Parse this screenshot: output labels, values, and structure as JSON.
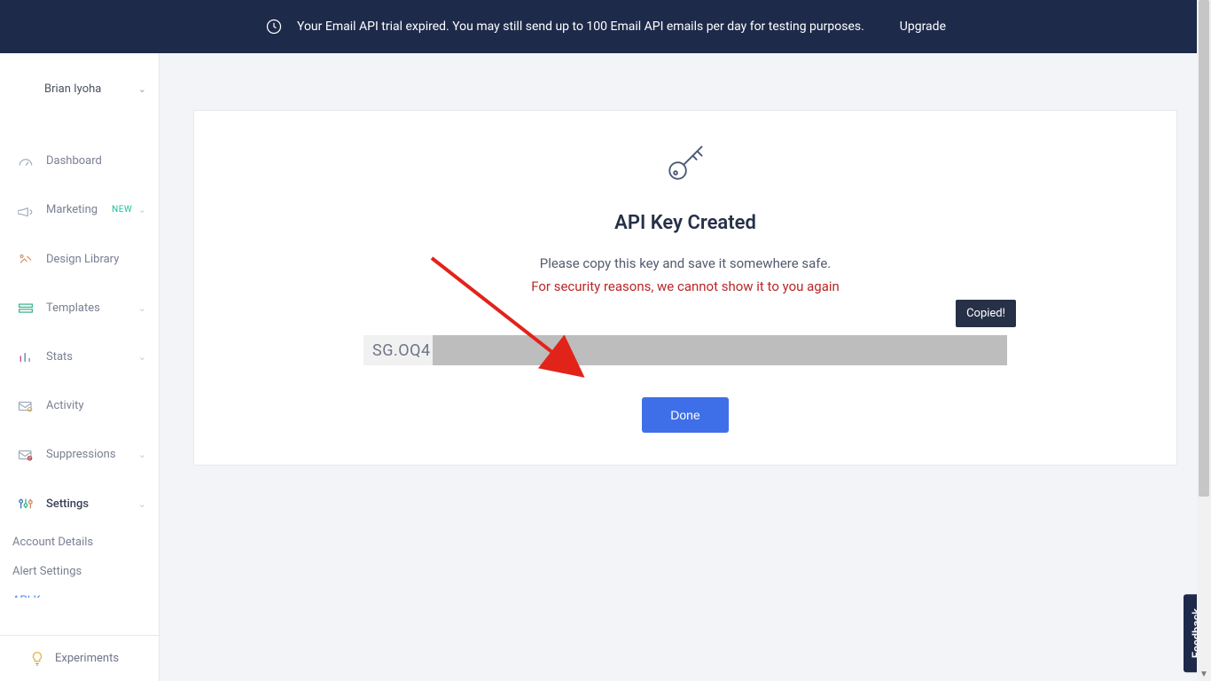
{
  "banner": {
    "message": "Your Email API trial expired. You may still send up to 100 Email API emails per day for testing purposes.",
    "upgrade": "Upgrade"
  },
  "user": {
    "name": "Brian Iyoha"
  },
  "nav": {
    "dashboard": "Dashboard",
    "marketing": "Marketing",
    "marketing_badge": "NEW",
    "design_library": "Design Library",
    "templates": "Templates",
    "stats": "Stats",
    "activity": "Activity",
    "suppressions": "Suppressions",
    "settings": "Settings"
  },
  "subnav": {
    "account_details": "Account Details",
    "alert_settings": "Alert Settings",
    "api_keys": "API Keys"
  },
  "footer": {
    "experiments": "Experiments"
  },
  "card": {
    "title": "API Key Created",
    "subtitle": "Please copy this key and save it somewhere safe.",
    "warning": "For security reasons, we cannot show it to you again",
    "key_prefix": "SG.OQ4",
    "copied": "Copied!",
    "done": "Done"
  },
  "feedback": {
    "label": "Feedback"
  }
}
